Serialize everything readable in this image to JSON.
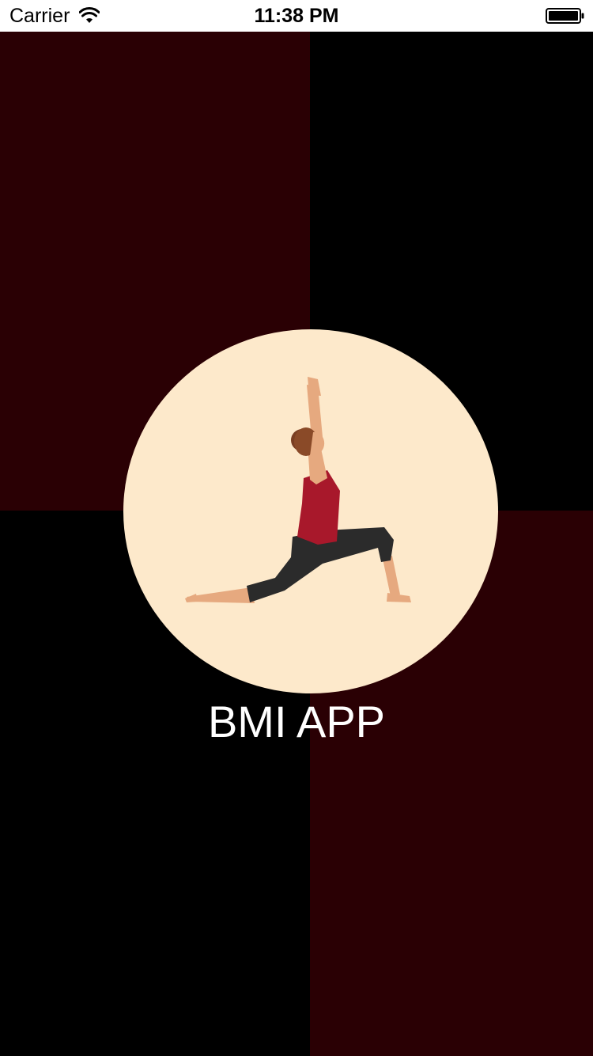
{
  "status_bar": {
    "carrier": "Carrier",
    "time": "11:38 PM",
    "wifi_icon": "wifi-icon",
    "battery_icon": "battery-icon"
  },
  "splash": {
    "title": "BMI APP",
    "logo_icon": "yoga-pose-icon"
  },
  "colors": {
    "dark_red": "#2a0004",
    "black": "#000000",
    "logo_circle": "#fde9cb",
    "title_text": "#ffffff"
  }
}
